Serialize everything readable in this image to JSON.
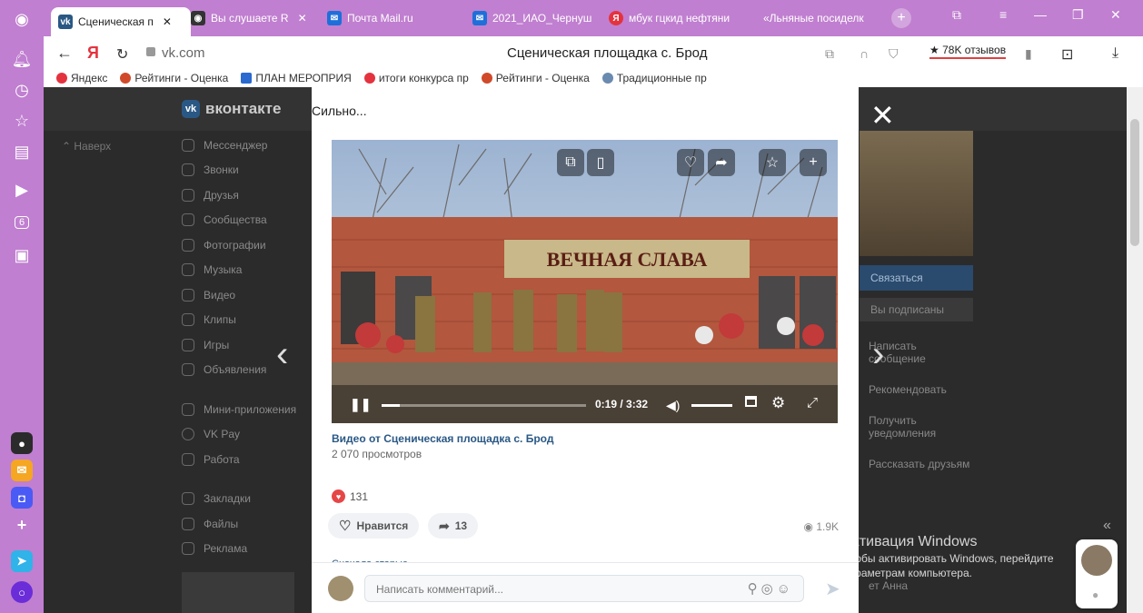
{
  "browser": {
    "tabs": [
      {
        "label": "Сценическая п",
        "color": "#2a5885",
        "fav": "vk",
        "active": true
      },
      {
        "label": "Вы слушаете R",
        "color": "#333333",
        "fav": "",
        "active": false
      },
      {
        "label": "Почта Mail.ru",
        "color": "#1e6fd9",
        "fav": "✉",
        "active": false
      },
      {
        "label": "2021_ИАО_Чернуш",
        "color": "#1e6fd9",
        "fav": "✉",
        "active": false
      },
      {
        "label": "мбук гцкид нефтяни",
        "color": "#e4333e",
        "fav": "Я",
        "active": false
      },
      {
        "label": "«Льняные посиделк",
        "color": "#c07fd0",
        "fav": "",
        "active": false
      }
    ],
    "address": {
      "url": "vk.com",
      "page_title": "Сценическая площадка с. Брод",
      "reviews": "★ 78K отзывов"
    },
    "bookmarks": [
      {
        "label": "Яндекс",
        "color": "#e4333e"
      },
      {
        "label": "Рейтинги - Оценка",
        "color": "#d04a2a"
      },
      {
        "label": "ПЛАН МЕРОПРИЯ",
        "color": "#2a6ad0"
      },
      {
        "label": "итоги конкурса пр",
        "color": "#e4333e"
      },
      {
        "label": "Рейтинги - Оценка",
        "color": "#d04a2a"
      },
      {
        "label": "Традиционные пр",
        "color": "#6a8ab0"
      }
    ],
    "rail_badge": "6"
  },
  "vk": {
    "logo": "вконтакте",
    "back": "Наверх",
    "menu": [
      "Мессенджер",
      "Звонки",
      "Друзья",
      "Сообщества",
      "Фотографии",
      "Музыка",
      "Видео",
      "Клипы",
      "Игры",
      "Объявления"
    ],
    "menu2": [
      "Мини-приложения",
      "VK Pay",
      "Работа"
    ],
    "menu3": [
      "Закладки",
      "Файлы",
      "Реклама"
    ],
    "right": {
      "connect": "Связаться",
      "subscribed": "Вы подписаны",
      "links": [
        "Написать сообщение",
        "Рекомендовать",
        "Получить уведомления",
        "Рассказать друзьям"
      ],
      "name": "ет Анна"
    }
  },
  "post": {
    "text": "Сильно...",
    "banner": "ВЕЧНАЯ СЛАВА",
    "time": "0:19 / 3:32",
    "progress": 0.09,
    "video_title": "Видео от Сценическая площадка с. Брод",
    "video_views": "2 070 просмотров",
    "likes": "131",
    "like_label": "Нравится",
    "shares": "13",
    "views": "1.9K",
    "comments_hint": "Сначала старые",
    "comment_placeholder": "Написать комментарий..."
  },
  "windows": {
    "title": "Активация Windows",
    "line1": "Чтобы активировать Windows, перейдите",
    "line2": "параметрам компьютера."
  }
}
